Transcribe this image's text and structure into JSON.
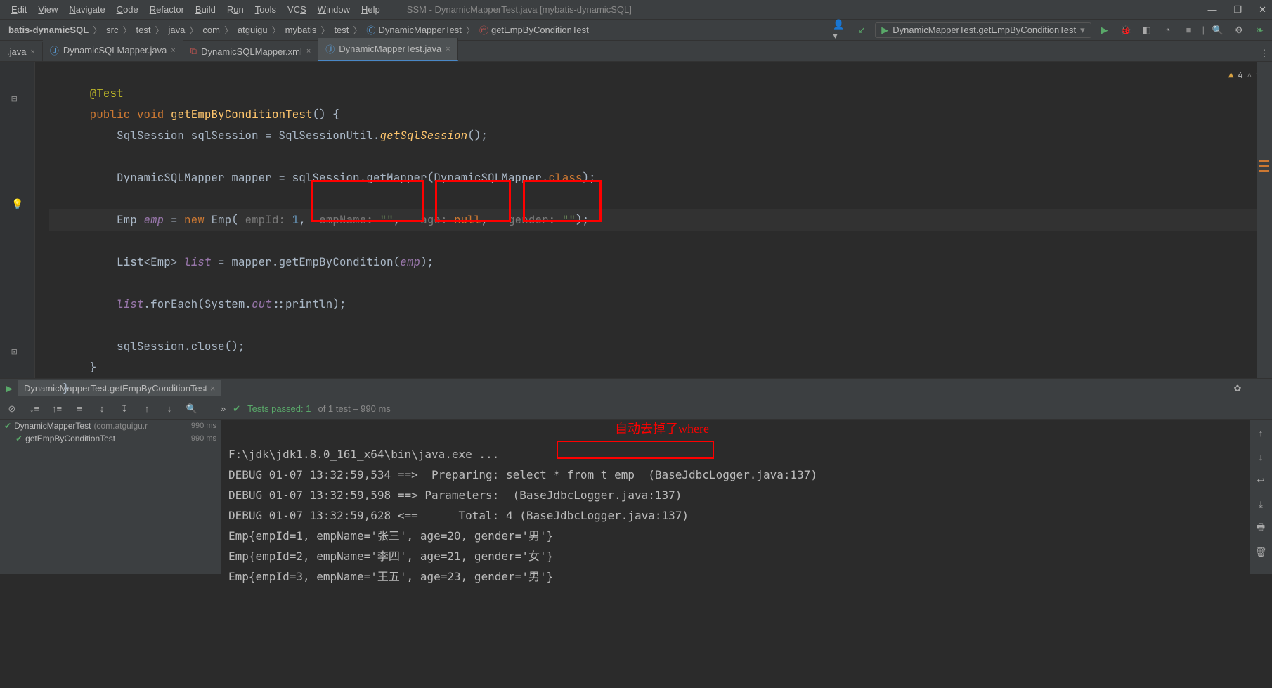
{
  "menu": {
    "items": [
      "Edit",
      "View",
      "Navigate",
      "Code",
      "Refactor",
      "Build",
      "Run",
      "Tools",
      "VCS",
      "Window",
      "Help"
    ]
  },
  "title": "SSM - DynamicMapperTest.java [mybatis-dynamicSQL]",
  "breadcrumbs": [
    "batis-dynamicSQL",
    "src",
    "test",
    "java",
    "com",
    "atguigu",
    "mybatis",
    "test",
    "DynamicMapperTest",
    "getEmpByConditionTest"
  ],
  "runconfig": "DynamicMapperTest.getEmpByConditionTest",
  "tabs": [
    {
      "label": ".java",
      "active": false,
      "icon": "java"
    },
    {
      "label": "DynamicSQLMapper.java",
      "active": false,
      "icon": "java"
    },
    {
      "label": "DynamicSQLMapper.xml",
      "active": false,
      "icon": "xml"
    },
    {
      "label": "DynamicMapperTest.java",
      "active": true,
      "icon": "java"
    }
  ],
  "code": {
    "anno": "@Test",
    "sig_pub": "public",
    "sig_void": "void",
    "sig_name": "getEmpByConditionTest",
    "l1a": "SqlSession sqlSession = SqlSessionUtil.",
    "l1b": "getSqlSession",
    "l1c": "();",
    "l2": "DynamicSQLMapper mapper = sqlSession.getMapper(DynamicSQLMapper.",
    "l2b": "class",
    "l2c": ");",
    "l3a": "Emp ",
    "l3b": "emp",
    "l3c": " = ",
    "l3d": "new",
    "l3e": " Emp( ",
    "l3f": "empId: ",
    "l3g": "1",
    "l3h": ", ",
    "l3i": "empName: ",
    "l3j": "\"\"",
    "l3k": ", ",
    "l3l": "age: ",
    "l3m": "null",
    "l3n": ", ",
    "l3o": "gender: ",
    "l3p": "\"\"",
    "l3q": ");",
    "l4a": "List<Emp> ",
    "l4b": "list",
    "l4c": " = mapper.getEmpByCondition(",
    "l4d": "emp",
    "l4e": ");",
    "l5a": "list",
    "l5b": ".forEach(System.",
    "l5c": "out",
    "l5d": "::println);",
    "l6": "sqlSession.close();"
  },
  "editor_status": {
    "warn": "4"
  },
  "run": {
    "tab": "DynamicMapperTest.getEmpByConditionTest",
    "status_pass": "Tests passed: 1",
    "status_of": " of 1 test – 990 ms",
    "tree": [
      {
        "name": "DynamicMapperTest",
        "pkg": "(com.atguigu.r",
        "ms": "990 ms"
      },
      {
        "name": "getEmpByConditionTest",
        "ms": "990 ms"
      }
    ],
    "anno": "自动去掉了where",
    "lines": [
      "F:\\jdk\\jdk1.8.0_161_x64\\bin\\java.exe ...",
      "DEBUG 01-07 13:32:59,534 ==>  Preparing: select * from t_emp  (BaseJdbcLogger.java:137)",
      "DEBUG 01-07 13:32:59,598 ==> Parameters:  (BaseJdbcLogger.java:137)",
      "DEBUG 01-07 13:32:59,628 <==      Total: 4 (BaseJdbcLogger.java:137)",
      "Emp{empId=1, empName='张三', age=20, gender='男'}",
      "Emp{empId=2, empName='李四', age=21, gender='女'}",
      "Emp{empId=3, empName='王五', age=23, gender='男'}"
    ]
  }
}
